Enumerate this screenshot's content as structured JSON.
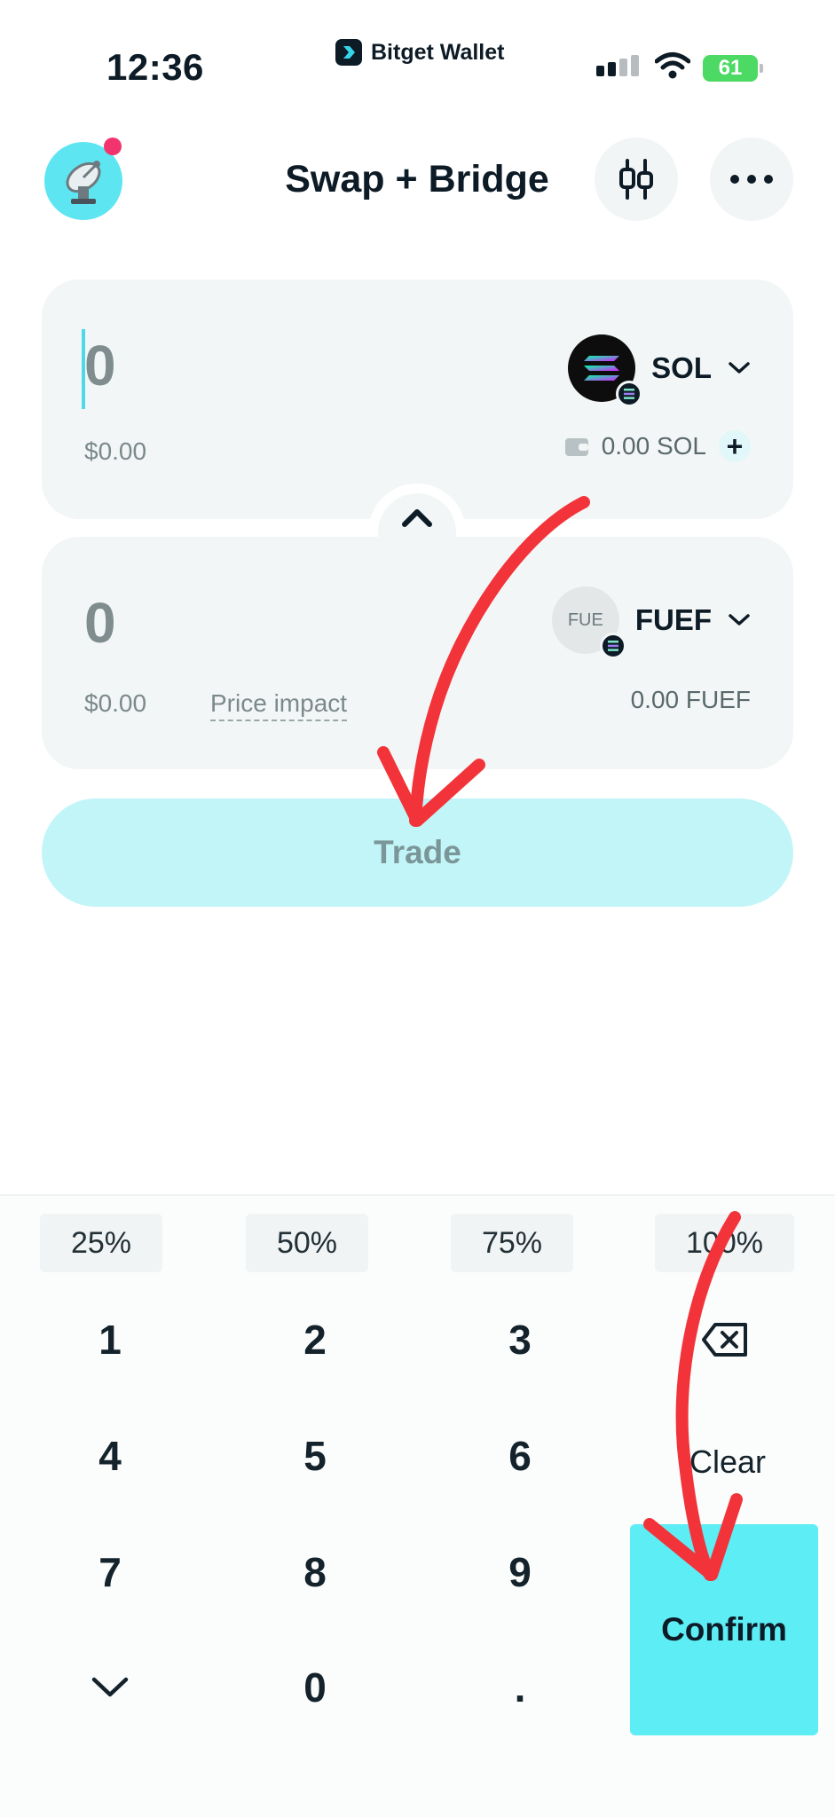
{
  "status_bar": {
    "time": "12:36",
    "carrier_label": "Bitget Wallet",
    "battery": "61"
  },
  "header": {
    "title": "Swap + Bridge",
    "avatar_icon": "satellite-dish-icon",
    "chart_icon": "candlestick-icon",
    "more_icon": "more-horizontal-icon"
  },
  "from": {
    "amount": "0",
    "usd": "$0.00",
    "token": "SOL",
    "balance": "0.00 SOL",
    "add_label": "+"
  },
  "to": {
    "amount": "0",
    "usd": "$0.00",
    "price_impact_label": "Price impact",
    "token": "FUEF",
    "token_icon_text": "FUE",
    "balance": "0.00 FUEF"
  },
  "trade_label": "Trade",
  "keypad": {
    "percents": [
      "25%",
      "50%",
      "75%",
      "100%"
    ],
    "keys": [
      "1",
      "2",
      "3",
      "4",
      "5",
      "6",
      "7",
      "8",
      "9",
      ".",
      "0"
    ],
    "clear_label": "Clear",
    "confirm_label": "Confirm"
  },
  "colors": {
    "accent": "#5dedf5",
    "trade_disabled": "#c2f5f8",
    "annotation_arrow": "#f2343a",
    "card_bg": "#f3f6f6"
  }
}
